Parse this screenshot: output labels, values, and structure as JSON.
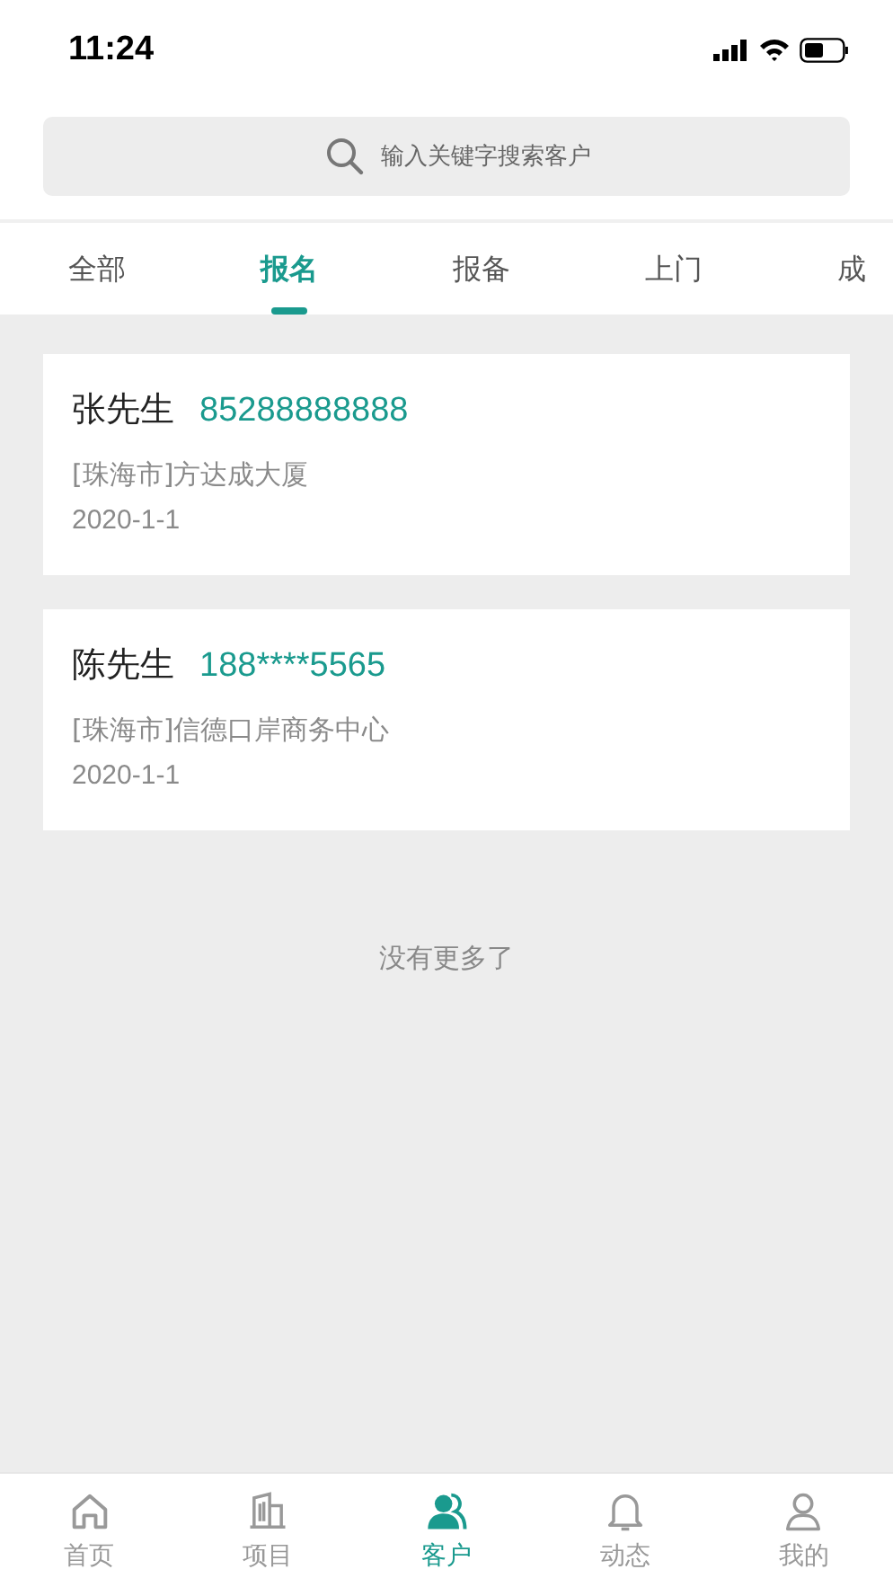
{
  "status_bar": {
    "time": "11:24"
  },
  "search": {
    "placeholder": "输入关键字搜索客户"
  },
  "tabs": [
    {
      "label": "全部",
      "selected": false
    },
    {
      "label": "报名",
      "selected": true
    },
    {
      "label": "报备",
      "selected": false
    },
    {
      "label": "上门",
      "selected": false
    },
    {
      "label": "成",
      "selected": false
    }
  ],
  "customers": [
    {
      "name": "张先生",
      "phone": "85288888888",
      "address": "[珠海市]方达成大厦",
      "date": "2020-1-1"
    },
    {
      "name": "陈先生",
      "phone": "188****5565",
      "address": "[珠海市]信德口岸商务中心",
      "date": "2020-1-1"
    }
  ],
  "list_end": "没有更多了",
  "bottom_nav": [
    {
      "label": "首页",
      "kind": "home",
      "selected": false
    },
    {
      "label": "项目",
      "kind": "building",
      "selected": false
    },
    {
      "label": "客户",
      "kind": "customers",
      "selected": true
    },
    {
      "label": "动态",
      "kind": "bell",
      "selected": false
    },
    {
      "label": "我的",
      "kind": "person",
      "selected": false
    }
  ]
}
